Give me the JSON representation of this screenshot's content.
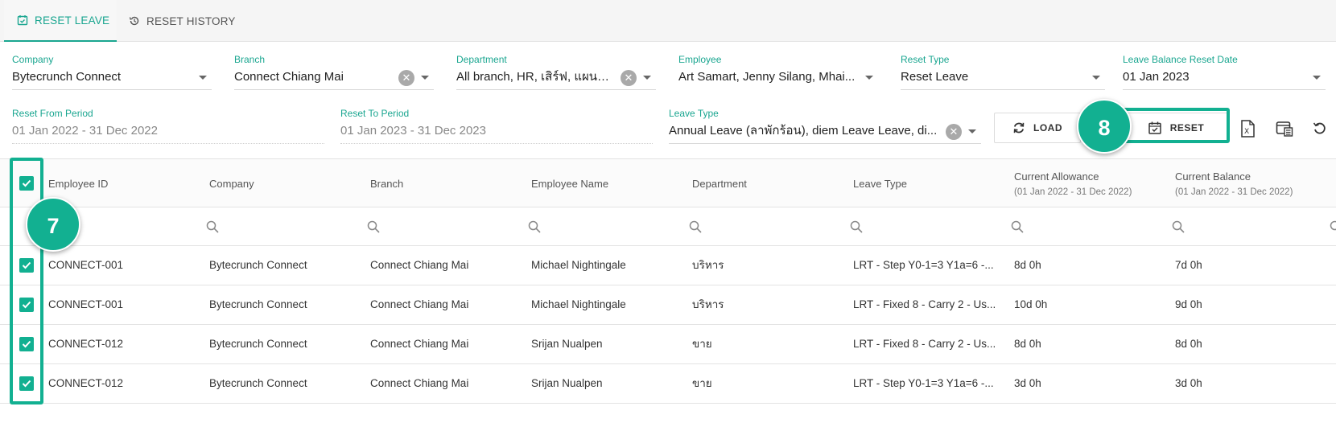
{
  "tabs": [
    {
      "label": "RESET LEAVE",
      "active": true
    },
    {
      "label": "RESET HISTORY",
      "active": false
    }
  ],
  "filters": {
    "company": {
      "label": "Company",
      "value": "Bytecrunch Connect"
    },
    "branch": {
      "label": "Branch",
      "value": "Connect Chiang Mai"
    },
    "department": {
      "label": "Department",
      "value": "All branch, HR, เสิร์ฟ, แผนกใ..."
    },
    "employee": {
      "label": "Employee",
      "value": "Art Samart, Jenny Silang, Mhai..."
    },
    "reset_type": {
      "label": "Reset Type",
      "value": "Reset Leave"
    },
    "reset_date": {
      "label": "Leave Balance Reset Date",
      "value": "01 Jan 2023"
    },
    "from_period": {
      "label": "Reset From Period",
      "value": "01 Jan 2022 - 31 Dec 2022"
    },
    "to_period": {
      "label": "Reset To Period",
      "value": "01 Jan 2023 - 31 Dec 2023"
    },
    "leave_type": {
      "label": "Leave Type",
      "value": "Annual Leave (ลาพักร้อน), diem Leave Leave, di..."
    }
  },
  "buttons": {
    "load": "LOAD",
    "reset": "RESET"
  },
  "icons": {
    "excel": "excel-export-icon",
    "columns": "column-settings-icon",
    "refresh": "refresh-icon"
  },
  "callouts": {
    "seven": "7",
    "eight": "8"
  },
  "colors": {
    "accent": "#12b091",
    "tab_accent": "#1aa690"
  },
  "table": {
    "columns": {
      "employee_id": "Employee ID",
      "company": "Company",
      "branch": "Branch",
      "employee_name": "Employee Name",
      "department": "Department",
      "leave_type": "Leave Type",
      "current_allowance": "Current Allowance",
      "current_allowance_sub": "(01 Jan 2022 - 31 Dec 2022)",
      "current_balance": "Current Balance",
      "current_balance_sub": "(01 Jan 2022 - 31 Dec 2022)"
    },
    "rows": [
      {
        "id": "CONNECT-001",
        "company": "Bytecrunch Connect",
        "branch": "Connect Chiang Mai",
        "name": "Michael Nightingale",
        "dept": "บริหาร",
        "leave": "LRT - Step Y0-1=3 Y1a=6 -...",
        "allowance": "8d 0h",
        "balance": "7d 0h"
      },
      {
        "id": "CONNECT-001",
        "company": "Bytecrunch Connect",
        "branch": "Connect Chiang Mai",
        "name": "Michael Nightingale",
        "dept": "บริหาร",
        "leave": "LRT - Fixed 8 - Carry 2 - Us...",
        "allowance": "10d 0h",
        "balance": "9d 0h"
      },
      {
        "id": "CONNECT-012",
        "company": "Bytecrunch Connect",
        "branch": "Connect Chiang Mai",
        "name": "Srijan Nualpen",
        "dept": "ขาย",
        "leave": "LRT - Fixed 8 - Carry 2 - Us...",
        "allowance": "8d 0h",
        "balance": "8d 0h"
      },
      {
        "id": "CONNECT-012",
        "company": "Bytecrunch Connect",
        "branch": "Connect Chiang Mai",
        "name": "Srijan Nualpen",
        "dept": "ขาย",
        "leave": "LRT - Step Y0-1=3 Y1a=6 -...",
        "allowance": "3d 0h",
        "balance": "3d 0h"
      }
    ]
  }
}
